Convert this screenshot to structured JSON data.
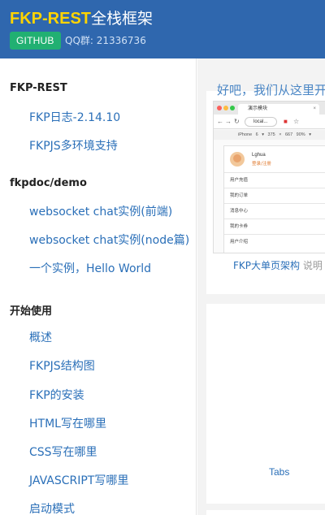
{
  "header": {
    "title_strong": "FKP-REST",
    "title_light": "全栈框架",
    "github_label": "GITHUB",
    "qq_text": "QQ群: 21336736"
  },
  "sidebar": {
    "sections": [
      {
        "title": "FKP-REST",
        "items": [
          "FKP日志-2.14.10",
          "FKPJS多环境支持"
        ]
      },
      {
        "title": "fkpdoc/demo",
        "items": [
          "websocket chat实例(前端)",
          "websocket chat实例(node篇)",
          "一个实例，Hello World"
        ]
      },
      {
        "title": "开始使用",
        "items": [
          "概述",
          "FKPJS结构图",
          "FKP的安装",
          "HTML写在哪里",
          "CSS写在哪里",
          "JAVASCRIPT写哪里",
          "启动模式"
        ]
      }
    ]
  },
  "content": {
    "intro": "好吧，我们从这里开",
    "browser": {
      "tab_title": "演示模块",
      "tab_close": "×",
      "address": "local...",
      "device_bar": "iPhone 6 ▾ 375 × 667 90% ▾",
      "user_name": "Lghua",
      "user_status": "登录/注册",
      "menu_items": [
        "用户充值",
        "我的订单",
        "消息中心",
        "我的卡券",
        "用户介绍"
      ]
    },
    "caption_link": "FKP大单页架构",
    "caption_note": " 说明",
    "tabs_label": "Tabs"
  },
  "colors": {
    "header_bg": "#2f67ae",
    "brand_yellow": "#ffd400",
    "github_green": "#21b072",
    "link_blue": "#2a6fb8"
  }
}
